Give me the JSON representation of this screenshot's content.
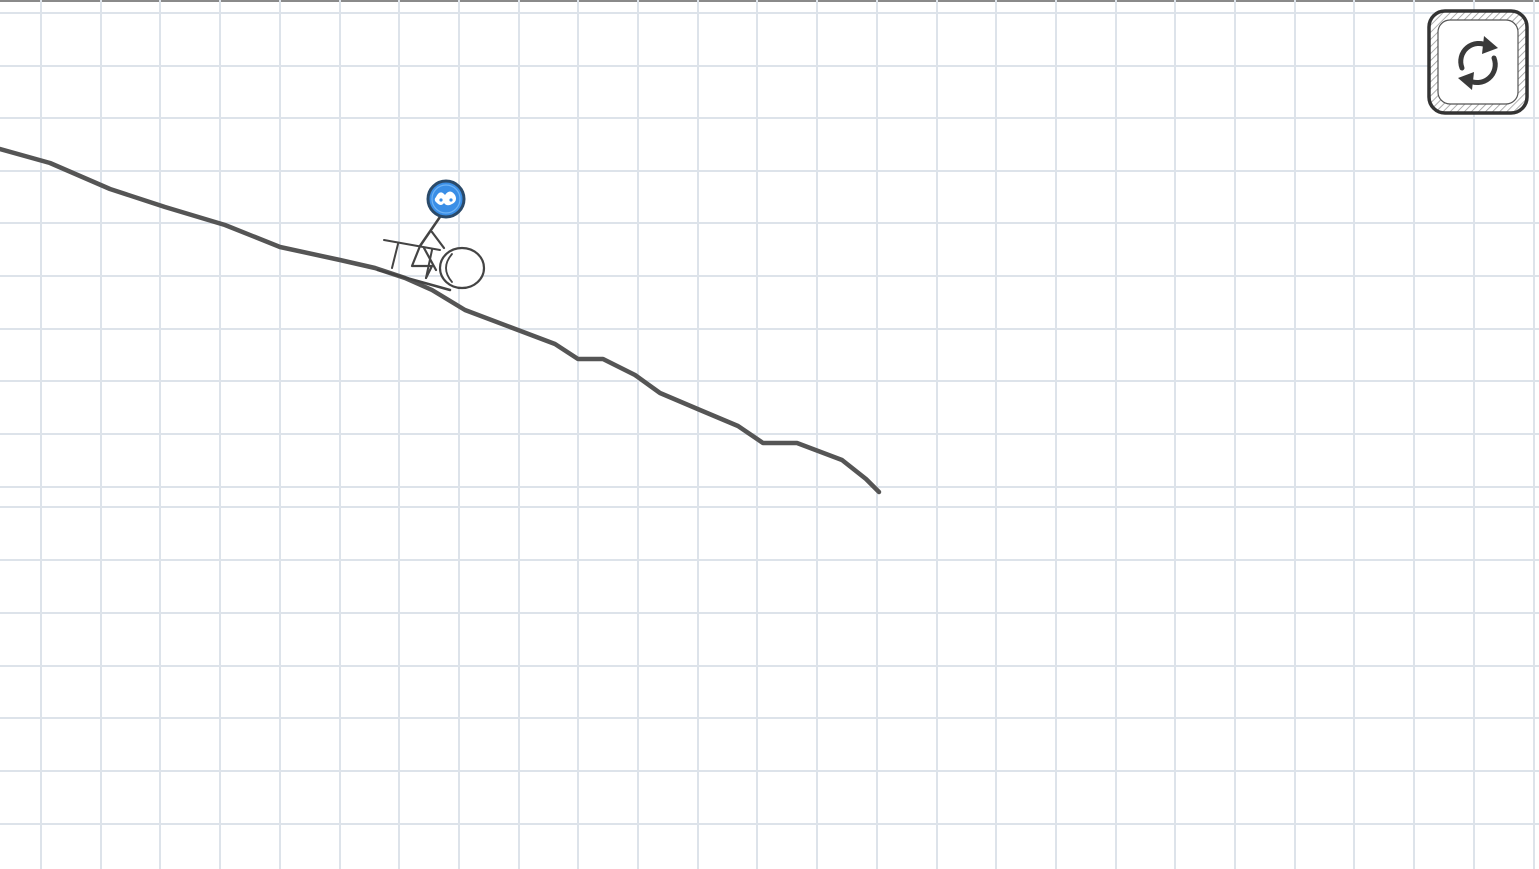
{
  "game": {
    "scene": "sketch-sled-ride",
    "background": "graph-paper",
    "colors": {
      "paper": "#ffffff",
      "grid": "#dde3ea",
      "track": "#555555",
      "rider_head": "#3a8ee6",
      "rider_head_outline": "#2a4a6a",
      "ink": "#444444"
    }
  },
  "controls": {
    "restart": {
      "icon": "restart-arrows-icon"
    }
  }
}
